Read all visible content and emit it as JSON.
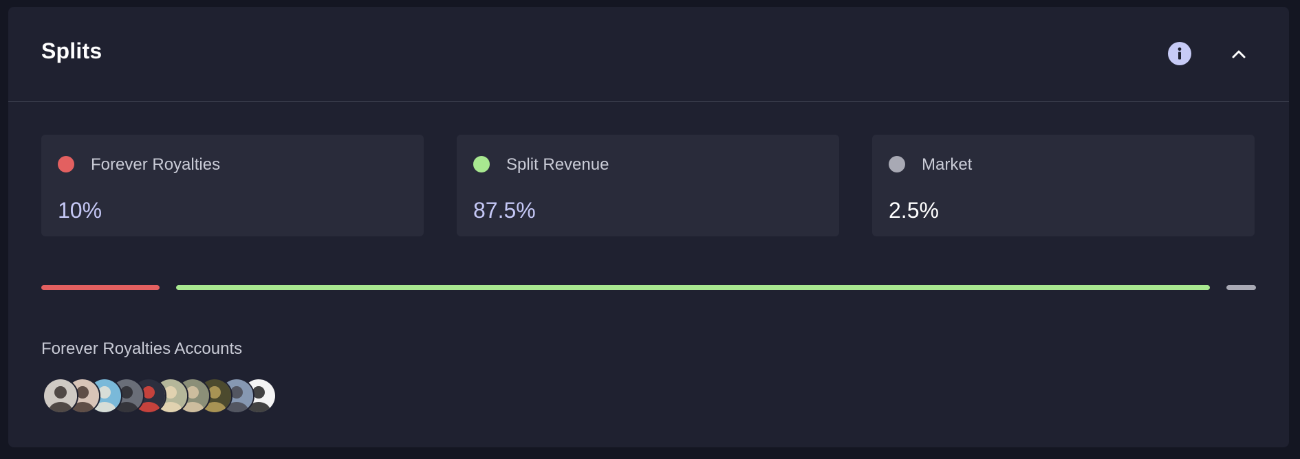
{
  "header": {
    "title": "Splits",
    "info_icon": "info-icon",
    "collapse_icon": "chevron-up-icon"
  },
  "splits": [
    {
      "label": "Forever Royalties",
      "value": "10%",
      "fraction": 0.1,
      "color": "#e36060",
      "value_color": "#c5c8f6"
    },
    {
      "label": "Split Revenue",
      "value": "87.5%",
      "fraction": 0.875,
      "color": "#a8e890",
      "value_color": "#c5c8f6"
    },
    {
      "label": "Market",
      "value": "2.5%",
      "fraction": 0.025,
      "color": "#a8a9b4",
      "value_color": "#ffffff"
    }
  ],
  "accounts": {
    "label": "Forever Royalties Accounts",
    "avatars": [
      {
        "name": "avatar-1",
        "bg": "#cfcac4",
        "fg": "#3a3230"
      },
      {
        "name": "avatar-2",
        "bg": "#d8c4b8",
        "fg": "#4a3a32"
      },
      {
        "name": "avatar-3",
        "bg": "#7ab9d9",
        "fg": "#e8e3d6"
      },
      {
        "name": "avatar-4",
        "bg": "#6a6e78",
        "fg": "#2c2c30"
      },
      {
        "name": "avatar-5",
        "bg": "#2c2f3e",
        "fg": "#e0453c"
      },
      {
        "name": "avatar-6",
        "bg": "#b5b79a",
        "fg": "#e9d7b4"
      },
      {
        "name": "avatar-7",
        "bg": "#8b8f78",
        "fg": "#d8c6a4"
      },
      {
        "name": "avatar-8",
        "bg": "#4c4a2e",
        "fg": "#b8a05a"
      },
      {
        "name": "avatar-9",
        "bg": "#8698b2",
        "fg": "#4a4a52"
      },
      {
        "name": "avatar-10",
        "bg": "#f4f4f4",
        "fg": "#222222"
      }
    ]
  }
}
